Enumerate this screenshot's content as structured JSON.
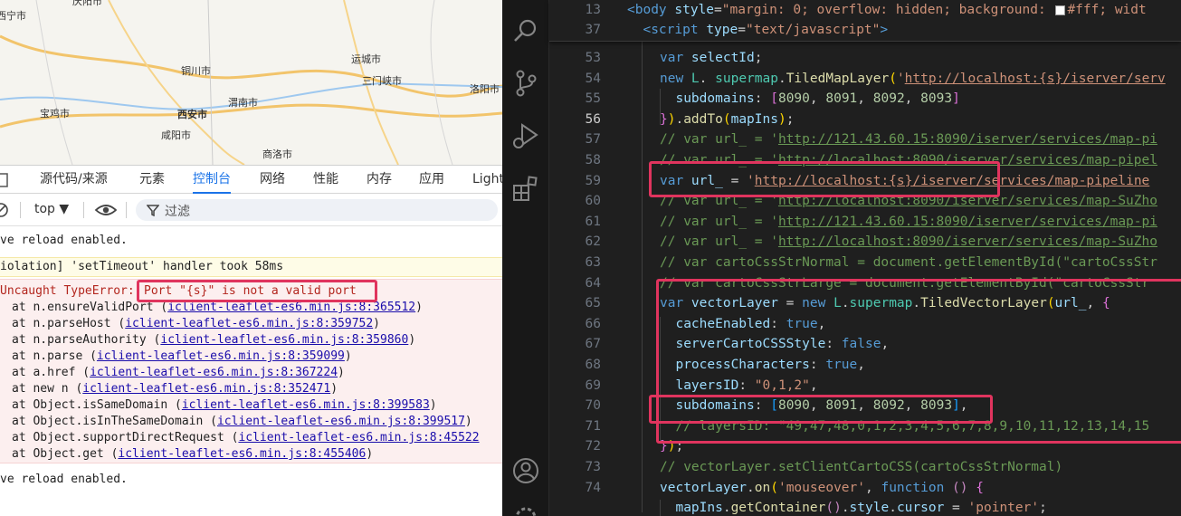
{
  "map": {
    "cities": [
      "西宁市",
      "庆阳市",
      "运城市",
      "铜川市",
      "三门峡市",
      "洛阳市",
      "渭南市",
      "宝鸡市",
      "西安市",
      "咸阳市",
      "商洛市"
    ]
  },
  "devtools": {
    "tabs": [
      "源代码/来源",
      "元素",
      "控制台",
      "网络",
      "性能",
      "内存",
      "应用",
      "Light"
    ],
    "active_tab": "控制台",
    "context": "top ▼",
    "filter_label": "过滤"
  },
  "console": {
    "lines": [
      "ve reload enabled.",
      "iolation] 'setTimeout' handler took 58ms",
      "Uncaught TypeError:",
      "Port \"{s}\" is not a valid port",
      "ve reload enabled."
    ],
    "stack": [
      {
        "pre": "at n.ensureValidPort (",
        "link": "iclient-leaflet-es6.min.js:8:365512",
        "post": ")"
      },
      {
        "pre": "at n.parseHost (",
        "link": "iclient-leaflet-es6.min.js:8:359752",
        "post": ")"
      },
      {
        "pre": "at n.parseAuthority (",
        "link": "iclient-leaflet-es6.min.js:8:359860",
        "post": ")"
      },
      {
        "pre": "at n.parse (",
        "link": "iclient-leaflet-es6.min.js:8:359099",
        "post": ")"
      },
      {
        "pre": "at a.href (",
        "link": "iclient-leaflet-es6.min.js:8:367224",
        "post": ")"
      },
      {
        "pre": "at new n (",
        "link": "iclient-leaflet-es6.min.js:8:352471",
        "post": ")"
      },
      {
        "pre": "at Object.isSameDomain (",
        "link": "iclient-leaflet-es6.min.js:8:399583",
        "post": ")"
      },
      {
        "pre": "at Object.isInTheSameDomain (",
        "link": "iclient-leaflet-es6.min.js:8:399517",
        "post": ")"
      },
      {
        "pre": "at Object.supportDirectRequest (",
        "link": "iclient-leaflet-es6.min.js:8:45522",
        "post": ""
      },
      {
        "pre": "at Object.get (",
        "link": "iclient-leaflet-es6.min.js:8:455406",
        "post": ")"
      }
    ]
  },
  "editor": {
    "line_numbers": [
      "13",
      "37",
      "53",
      "54",
      "55",
      "56",
      "57",
      "58",
      "59",
      "60",
      "61",
      "62",
      "63",
      "64",
      "65",
      "66",
      "67",
      "68",
      "69",
      "70",
      "71",
      "72",
      "73",
      "74"
    ],
    "current_line": "56",
    "sticky": [
      {
        "tokens": [
          [
            "tag",
            "<"
          ],
          [
            "k",
            "body"
          ],
          [
            "v",
            " style"
          ],
          [
            "",
            "="
          ],
          [
            "s",
            "\"margin: 0; overflow: hidden; background: "
          ],
          [
            "sw",
            ""
          ],
          [
            "s",
            "#fff; widt"
          ]
        ]
      },
      {
        "tokens": [
          [
            "tag",
            "  <"
          ],
          [
            "k",
            "script"
          ],
          [
            "v",
            " type"
          ],
          [
            "",
            "="
          ],
          [
            "s",
            "\"text/javascript\""
          ],
          [
            "tag",
            ">"
          ]
        ]
      }
    ],
    "lines": [
      [
        [
          "k",
          "var "
        ],
        [
          "v",
          "selectId"
        ],
        [
          "",
          ";"
        ]
      ],
      [
        [
          "k",
          "new "
        ],
        [
          "t",
          "L"
        ],
        [
          "",
          ". "
        ],
        [
          "t",
          "supermap"
        ],
        [
          "",
          "."
        ],
        [
          "f",
          "TiledMapLayer"
        ],
        [
          "y",
          "("
        ],
        [
          "s",
          "'"
        ],
        [
          "su",
          "http://localhost:{s}/iserver/serv"
        ]
      ],
      [
        [
          "v",
          "  subdomains"
        ],
        [
          "",
          ": "
        ],
        [
          "p",
          "["
        ],
        [
          "n",
          "8090"
        ],
        [
          "",
          ", "
        ],
        [
          "n",
          "8091"
        ],
        [
          "",
          ", "
        ],
        [
          "n",
          "8092"
        ],
        [
          "",
          ", "
        ],
        [
          "n",
          "8093"
        ],
        [
          "p",
          "]"
        ]
      ],
      [
        [
          "p",
          "}"
        ],
        [
          "y",
          ")"
        ],
        [
          "",
          "."
        ],
        [
          "f",
          "addTo"
        ],
        [
          "y",
          "("
        ],
        [
          "v",
          "mapIns"
        ],
        [
          "y",
          ")"
        ],
        [
          "",
          ";"
        ]
      ],
      [
        [
          "cm",
          "// var url_ = '"
        ],
        [
          "cmu",
          "http://121.43.60.15:8090/iserver/services/map-pi"
        ]
      ],
      [
        [
          "cm",
          "// var url_ = '"
        ],
        [
          "cmu",
          "http://localhost:8090/iserver/services/map-pipel"
        ]
      ],
      [
        [
          "k",
          "var "
        ],
        [
          "v",
          "url_"
        ],
        [
          "",
          " = "
        ],
        [
          "s",
          "'"
        ],
        [
          "su",
          "http://localhost:{s}/iserver"
        ],
        [
          "su",
          "/services/map-pipeline"
        ]
      ],
      [
        [
          "cm",
          "// var url_ = '"
        ],
        [
          "cmu",
          "http://localhost:8090/iserver/services/map-SuZho"
        ]
      ],
      [
        [
          "cm",
          "// var url_ = '"
        ],
        [
          "cmu",
          "http://121.43.60.15:8090/iserver/services/map-pi"
        ]
      ],
      [
        [
          "cm",
          "// var url_ = '"
        ],
        [
          "cmu",
          "http://localhost:8090/iserver/services/map-SuZho"
        ]
      ],
      [
        [
          "cm",
          "// var cartoCssStrNormal = document.getElementById(\"cartoCssStr"
        ]
      ],
      [
        [
          "cm",
          "// var cartoCssStrLarge = document.getElementById(\"cartoCssStr"
        ]
      ],
      [
        [
          "k",
          "var "
        ],
        [
          "v",
          "vectorLayer"
        ],
        [
          "",
          " = "
        ],
        [
          "k",
          "new "
        ],
        [
          "t",
          "L"
        ],
        [
          "",
          "."
        ],
        [
          "t",
          "supermap"
        ],
        [
          "",
          "."
        ],
        [
          "f",
          "TiledVectorLayer"
        ],
        [
          "y",
          "("
        ],
        [
          "v",
          "url_"
        ],
        [
          "",
          ", "
        ],
        [
          "p",
          "{"
        ]
      ],
      [
        [
          "v",
          "  cacheEnabled"
        ],
        [
          "",
          ": "
        ],
        [
          "k",
          "true"
        ],
        [
          "",
          ","
        ]
      ],
      [
        [
          "v",
          "  serverCartoCSSStyle"
        ],
        [
          "",
          ": "
        ],
        [
          "k",
          "false"
        ],
        [
          "",
          ","
        ]
      ],
      [
        [
          "v",
          "  processCharacters"
        ],
        [
          "",
          ": "
        ],
        [
          "k",
          "true"
        ],
        [
          "",
          ","
        ]
      ],
      [
        [
          "v",
          "  layersID"
        ],
        [
          "",
          ": "
        ],
        [
          "s",
          "\"0,1,2\""
        ],
        [
          "",
          ","
        ]
      ],
      [
        [
          "v",
          "  subdomains"
        ],
        [
          "",
          ": "
        ],
        [
          "b",
          "["
        ],
        [
          "n",
          "8090"
        ],
        [
          "",
          ", "
        ],
        [
          "n",
          "8091"
        ],
        [
          "",
          ", "
        ],
        [
          "n",
          "8092"
        ],
        [
          "",
          ", "
        ],
        [
          "n",
          "8093"
        ],
        [
          "b",
          "]"
        ],
        [
          "",
          ","
        ]
      ],
      [
        [
          "cm",
          "  // layersID: \"49,47,48,0,1,2,3,4,5,6,7,8,9,10,11,12,13,14,15"
        ]
      ],
      [
        [
          "p",
          "}"
        ],
        [
          "y",
          ")"
        ],
        [
          "",
          ";"
        ]
      ],
      [
        [
          "cm",
          "// vectorLayer.setClientCartoCSS(cartoCssStrNormal)"
        ]
      ],
      [
        [
          "v",
          "vectorLayer"
        ],
        [
          "",
          "."
        ],
        [
          "f",
          "on"
        ],
        [
          "y",
          "("
        ],
        [
          "s",
          "'mouseover'"
        ],
        [
          "",
          ", "
        ],
        [
          "k",
          "function "
        ],
        [
          "c",
          "() "
        ],
        [
          "p",
          "{"
        ]
      ],
      [
        [
          "v",
          "  mapIns"
        ],
        [
          "",
          "."
        ],
        [
          "f",
          "getContainer"
        ],
        [
          "c",
          "()"
        ],
        [
          "",
          "."
        ],
        [
          "v",
          "style"
        ],
        [
          "",
          "."
        ],
        [
          "v",
          "cursor"
        ],
        [
          "",
          " = "
        ],
        [
          "s",
          "'pointer'"
        ],
        [
          "",
          ";"
        ]
      ]
    ]
  },
  "colors": {
    "accent": "#1a73e8",
    "highlight": "#e0345e",
    "error_bg": "#fcefef",
    "editor_bg": "#1f1f1f"
  }
}
